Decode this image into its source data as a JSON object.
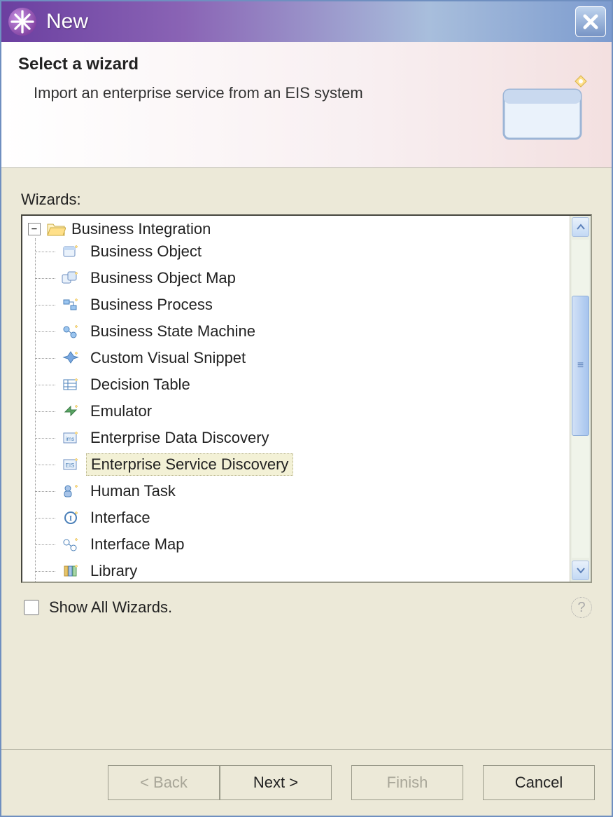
{
  "window": {
    "title": "New"
  },
  "banner": {
    "heading": "Select a wizard",
    "description": "Import an enterprise service from an EIS system"
  },
  "tree": {
    "label": "Wizards:",
    "root": {
      "label": "Business Integration",
      "expanded": true
    },
    "items": [
      {
        "label": "Business Object",
        "icon": "business-object-icon"
      },
      {
        "label": "Business Object Map",
        "icon": "business-object-map-icon"
      },
      {
        "label": "Business Process",
        "icon": "business-process-icon"
      },
      {
        "label": "Business State Machine",
        "icon": "business-state-machine-icon"
      },
      {
        "label": "Custom Visual Snippet",
        "icon": "custom-visual-snippet-icon"
      },
      {
        "label": "Decision Table",
        "icon": "decision-table-icon"
      },
      {
        "label": "Emulator",
        "icon": "emulator-icon"
      },
      {
        "label": "Enterprise Data Discovery",
        "icon": "enterprise-data-discovery-icon"
      },
      {
        "label": "Enterprise Service Discovery",
        "icon": "enterprise-service-discovery-icon",
        "selected": true
      },
      {
        "label": "Human Task",
        "icon": "human-task-icon"
      },
      {
        "label": "Interface",
        "icon": "interface-icon"
      },
      {
        "label": "Interface Map",
        "icon": "interface-map-icon"
      },
      {
        "label": "Library",
        "icon": "library-icon"
      }
    ]
  },
  "checkbox": {
    "label": "Show All Wizards.",
    "checked": false
  },
  "buttons": {
    "back": "< Back",
    "next": "Next >",
    "finish": "Finish",
    "cancel": "Cancel"
  },
  "colors": {
    "titlebar_start": "#6b3fa0",
    "titlebar_end": "#7d9ccf",
    "dialog_bg": "#ece9d8",
    "selection_bg": "#f3f1d6"
  }
}
